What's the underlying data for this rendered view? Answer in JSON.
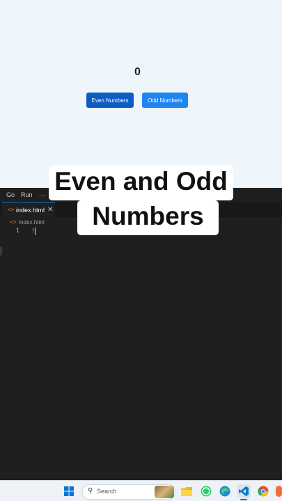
{
  "preview": {
    "counter_value": "0",
    "even_button_label": "Even Numbers",
    "odd_button_label": "Odd Numbers"
  },
  "caption": {
    "line1": "Even and Odd",
    "line2": "Numbers"
  },
  "vscode": {
    "menu": [
      "Go",
      "Run",
      "···"
    ],
    "tab_label": "index.html",
    "tab_close": "✕",
    "breadcrumb": "index.html",
    "line_number": "1",
    "code_line": "!"
  },
  "taskbar": {
    "search_placeholder": "Search"
  },
  "colors": {
    "even_button": "#0b5cc4",
    "odd_button": "#1d86f0",
    "editor_bg": "#1f1f1f",
    "preview_bg": "#eef5fb",
    "html_icon": "#e37933"
  },
  "icons": {
    "windows": "windows-start-icon",
    "search": "search-icon",
    "file_explorer": "folder-icon",
    "whatsapp": "whatsapp-icon",
    "edge": "edge-browser-icon",
    "vscode": "vscode-icon",
    "chrome": "chrome-icon"
  }
}
